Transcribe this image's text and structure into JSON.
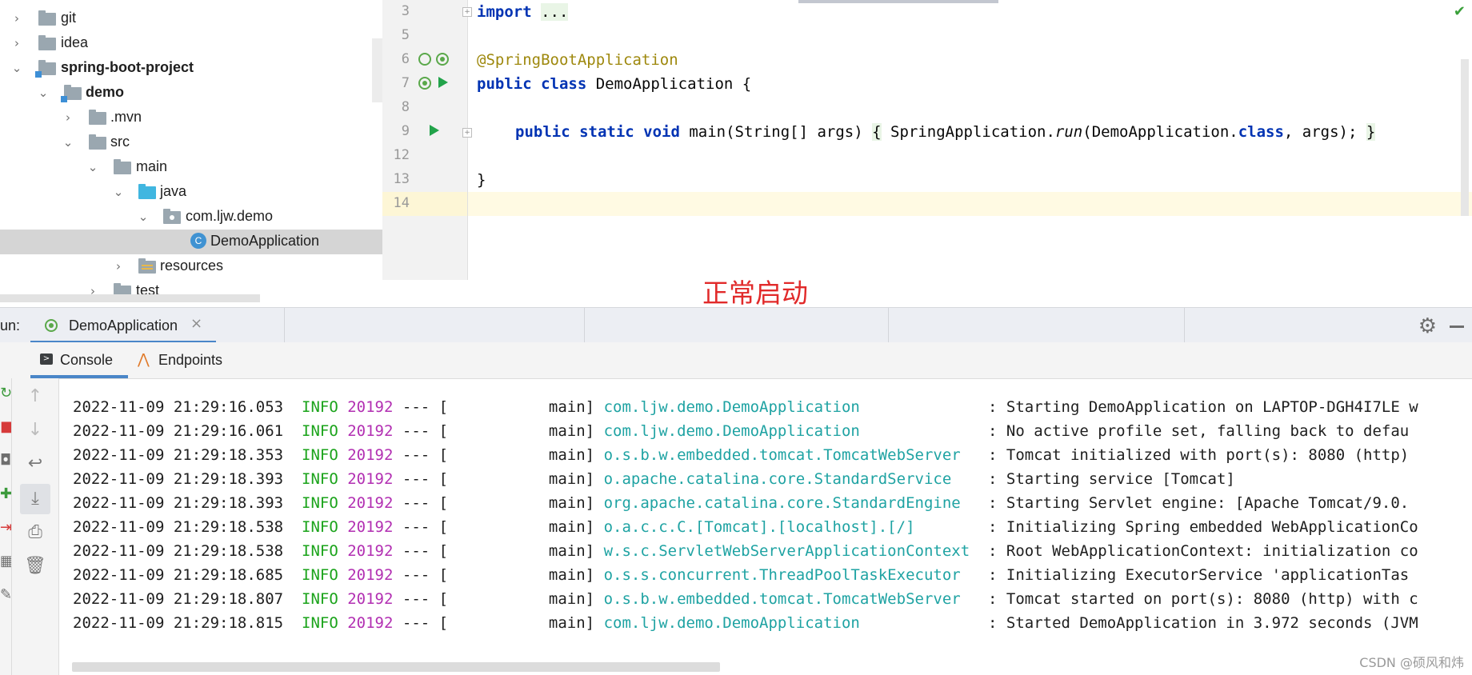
{
  "project_tree": {
    "items": [
      {
        "label": "git",
        "expanded": false,
        "icon": "folder-icon"
      },
      {
        "label": "idea",
        "expanded": false,
        "icon": "folder-icon"
      },
      {
        "label": "spring-boot-project",
        "expanded": true,
        "icon": "module-folder-icon"
      },
      {
        "label": "demo",
        "expanded": true,
        "icon": "module-folder-icon"
      },
      {
        "label": ".mvn",
        "expanded": false,
        "icon": "folder-icon"
      },
      {
        "label": "src",
        "expanded": true,
        "icon": "folder-icon"
      },
      {
        "label": "main",
        "expanded": true,
        "icon": "folder-icon"
      },
      {
        "label": "java",
        "expanded": true,
        "icon": "source-folder-icon"
      },
      {
        "label": "com.ljw.demo",
        "expanded": true,
        "icon": "package-icon"
      },
      {
        "label": "DemoApplication",
        "selected": true,
        "icon": "spring-class-icon"
      },
      {
        "label": "resources",
        "expanded": false,
        "icon": "resources-folder-icon"
      },
      {
        "label": "test",
        "expanded": false,
        "icon": "folder-icon"
      }
    ]
  },
  "editor": {
    "line_numbers": [
      "3",
      "5",
      "6",
      "7",
      "8",
      "9",
      "12",
      "13",
      "14"
    ],
    "code": {
      "l3_kw": "import",
      "l3_folded": "...",
      "l6_annotation": "@SpringBootApplication",
      "l7_kw1": "public",
      "l7_kw2": "class",
      "l7_rest": " DemoApplication {",
      "l9_kw": "public static void",
      "l9_sig": " main(String[] args) ",
      "l9_open": "{",
      "l9_call_a": " SpringApplication.",
      "l9_run": "run",
      "l9_call_b": "(DemoApplication.",
      "l9_class_kw": "class",
      "l9_call_c": ", args); ",
      "l9_close": "}",
      "l13_brace": "}"
    },
    "status_check": "✔"
  },
  "annotation_text": "正常启动",
  "run_window": {
    "label": "un:",
    "tab_label": "DemoApplication",
    "tab_close": "×",
    "settings_icon": "gear-icon",
    "sub_tabs": [
      {
        "label": "Console",
        "active": true
      },
      {
        "label": "Endpoints",
        "active": false
      }
    ],
    "toolbar_icons": [
      "arrow-up-icon",
      "arrow-down-icon",
      "soft-wrap-icon",
      "scroll-to-end-icon",
      "print-icon",
      "trash-icon"
    ]
  },
  "console_log": [
    {
      "ts": "2022-11-09 21:29:16.053",
      "level": "INFO",
      "pid": "20192",
      "sep": "---",
      "thread": "[           main]",
      "logger": "com.ljw.demo.DemoApplication",
      "msg": ": Starting DemoApplication on LAPTOP-DGH4I7LE w"
    },
    {
      "ts": "2022-11-09 21:29:16.061",
      "level": "INFO",
      "pid": "20192",
      "sep": "---",
      "thread": "[           main]",
      "logger": "com.ljw.demo.DemoApplication",
      "msg": ": No active profile set, falling back to defau"
    },
    {
      "ts": "2022-11-09 21:29:18.353",
      "level": "INFO",
      "pid": "20192",
      "sep": "---",
      "thread": "[           main]",
      "logger": "o.s.b.w.embedded.tomcat.TomcatWebServer",
      "msg": ": Tomcat initialized with port(s): 8080 (http)"
    },
    {
      "ts": "2022-11-09 21:29:18.393",
      "level": "INFO",
      "pid": "20192",
      "sep": "---",
      "thread": "[           main]",
      "logger": "o.apache.catalina.core.StandardService",
      "msg": ": Starting service [Tomcat]"
    },
    {
      "ts": "2022-11-09 21:29:18.393",
      "level": "INFO",
      "pid": "20192",
      "sep": "---",
      "thread": "[           main]",
      "logger": "org.apache.catalina.core.StandardEngine",
      "msg": ": Starting Servlet engine: [Apache Tomcat/9.0."
    },
    {
      "ts": "2022-11-09 21:29:18.538",
      "level": "INFO",
      "pid": "20192",
      "sep": "---",
      "thread": "[           main]",
      "logger": "o.a.c.c.C.[Tomcat].[localhost].[/]",
      "msg": ": Initializing Spring embedded WebApplicationCo"
    },
    {
      "ts": "2022-11-09 21:29:18.538",
      "level": "INFO",
      "pid": "20192",
      "sep": "---",
      "thread": "[           main]",
      "logger": "w.s.c.ServletWebServerApplicationContext",
      "msg": ": Root WebApplicationContext: initialization co"
    },
    {
      "ts": "2022-11-09 21:29:18.685",
      "level": "INFO",
      "pid": "20192",
      "sep": "---",
      "thread": "[           main]",
      "logger": "o.s.s.concurrent.ThreadPoolTaskExecutor",
      "msg": ": Initializing ExecutorService 'applicationTas"
    },
    {
      "ts": "2022-11-09 21:29:18.807",
      "level": "INFO",
      "pid": "20192",
      "sep": "---",
      "thread": "[           main]",
      "logger": "o.s.b.w.embedded.tomcat.TomcatWebServer",
      "msg": ": Tomcat started on port(s): 8080 (http) with c"
    },
    {
      "ts": "2022-11-09 21:29:18.815",
      "level": "INFO",
      "pid": "20192",
      "sep": "---",
      "thread": "[           main]",
      "logger": "com.ljw.demo.DemoApplication",
      "msg": ": Started DemoApplication in 3.972 seconds (JVM"
    }
  ],
  "watermark": "CSDN @硕风和炜",
  "colors": {
    "keyword": "#0033b3",
    "annotation": "#9e880d",
    "log_level": "#1aa31a",
    "log_pid": "#b22fb2",
    "log_logger": "#1fa3a3",
    "note_red": "#e12a2a",
    "tab_accent": "#4a86c8"
  }
}
